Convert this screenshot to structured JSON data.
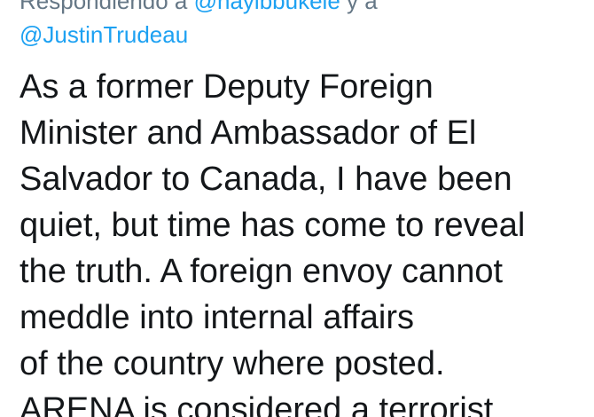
{
  "reply": {
    "prefix": "Respondiendo a ",
    "mention_1": "@nayibbukele",
    "connector": " y a",
    "mention_2": "@JustinTrudeau"
  },
  "tweet": {
    "lines": [
      "As a former Deputy Foreign",
      "Minister and Ambassador of El",
      "Salvador to Canada, I have been",
      "quiet, but time has come to reveal",
      "the truth. A foreign envoy cannot",
      "meddle into internal affairs",
      "of the country where posted.",
      "ARENA is considered a terrorist"
    ]
  },
  "colors": {
    "text": "#14171a",
    "secondary_text": "#657786",
    "mention": "#1da1f2",
    "background": "#ffffff"
  }
}
